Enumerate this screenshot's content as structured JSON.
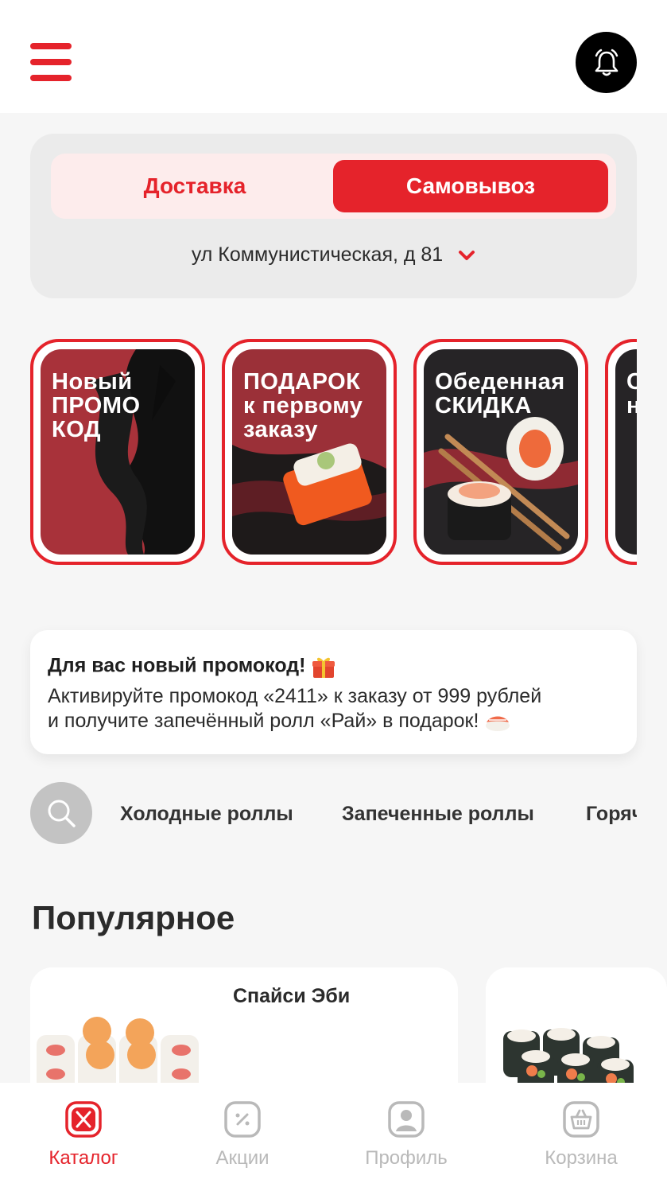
{
  "colors": {
    "accent": "#e5232b",
    "inactive": "#b9b9b9"
  },
  "header": {
    "menu_icon": "hamburger-icon",
    "notifications_icon": "bell-icon"
  },
  "delivery": {
    "options": [
      "Доставка",
      "Самовывоз"
    ],
    "selected": "Самовывоз",
    "address": "ул Коммунистическая, д 81"
  },
  "stories": [
    {
      "title": "Новый\nПРОМО\nКОД"
    },
    {
      "title": "ПОДАРОК\nк первому\nзаказу"
    },
    {
      "title": "Обеденная\nСКИДКА"
    },
    {
      "title": "С\nн"
    }
  ],
  "promo": {
    "title": "Для вас новый промокод!",
    "line1": "Активируйте промокод «2411» к заказу от 999 рублей",
    "line2": "и получите запечённый ролл «Рай» в подарок!",
    "title_emoji_icon": "gift-icon",
    "text_emoji_icon": "sushi-icon"
  },
  "categories": [
    "Холодные роллы",
    "Запеченные роллы",
    "Горяч"
  ],
  "popular": {
    "title": "Популярное",
    "items": [
      {
        "name": "Спайси Эби"
      }
    ]
  },
  "tabs": [
    {
      "label": "Каталог",
      "active": true
    },
    {
      "label": "Акции",
      "active": false
    },
    {
      "label": "Профиль",
      "active": false
    },
    {
      "label": "Корзина",
      "active": false
    }
  ]
}
